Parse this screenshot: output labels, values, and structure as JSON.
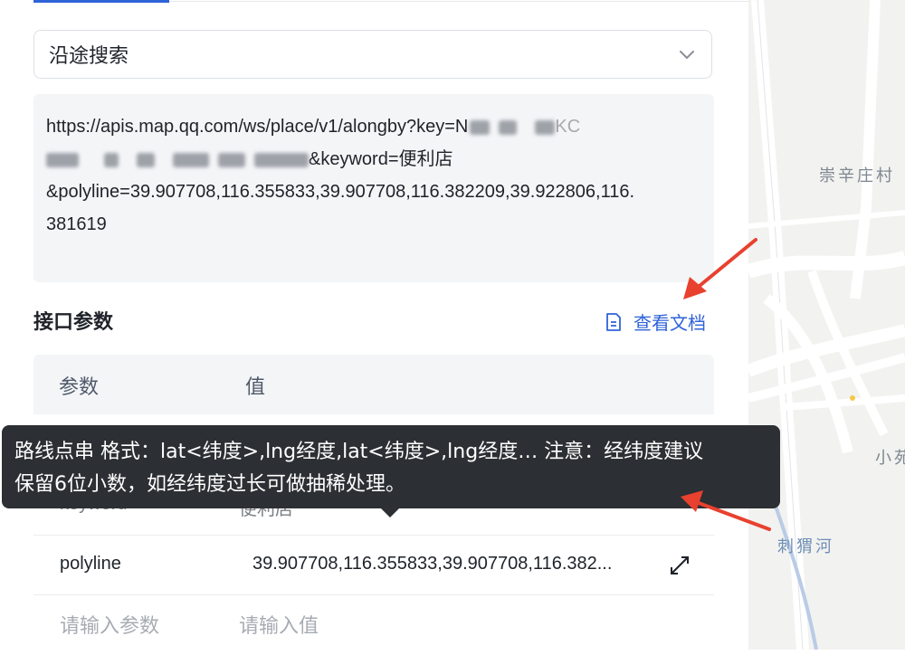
{
  "search_type": {
    "value": "沿途搜索"
  },
  "url": {
    "line1": "https://apis.map.qq.com/ws/place/v1/alongby?key=N",
    "line1_tail": "KC",
    "line2_tail": "&keyword=便利店",
    "line3": "&polyline=39.907708,116.355833,39.907708,116.382209,39.922806,116.",
    "line4": "381619"
  },
  "params": {
    "title": "接口参数",
    "doc_link": "查看文档",
    "headers": {
      "name": "参数",
      "value": "值"
    },
    "rows": [
      {
        "name": "keyword",
        "value": "便利店"
      },
      {
        "name": "polyline",
        "value": "39.907708,116.355833,39.907708,116.382..."
      }
    ],
    "new_row": {
      "name_placeholder": "请输入参数",
      "value_placeholder": "请输入值"
    }
  },
  "tooltip": {
    "line1": "路线点串 格式：lat<纬度>,lng经度,lat<纬度>,lng经度… 注意：经纬度建议",
    "line2": "保留6位小数，如经纬度过长可做抽稀处理。"
  },
  "map": {
    "labels": {
      "village": "崇辛庄村",
      "partial": "小苑",
      "river": "刺猬河"
    }
  },
  "colors": {
    "accent": "#2f63d8",
    "annotation_arrow": "#e8412f",
    "tooltip_bg": "#2c2f33"
  }
}
